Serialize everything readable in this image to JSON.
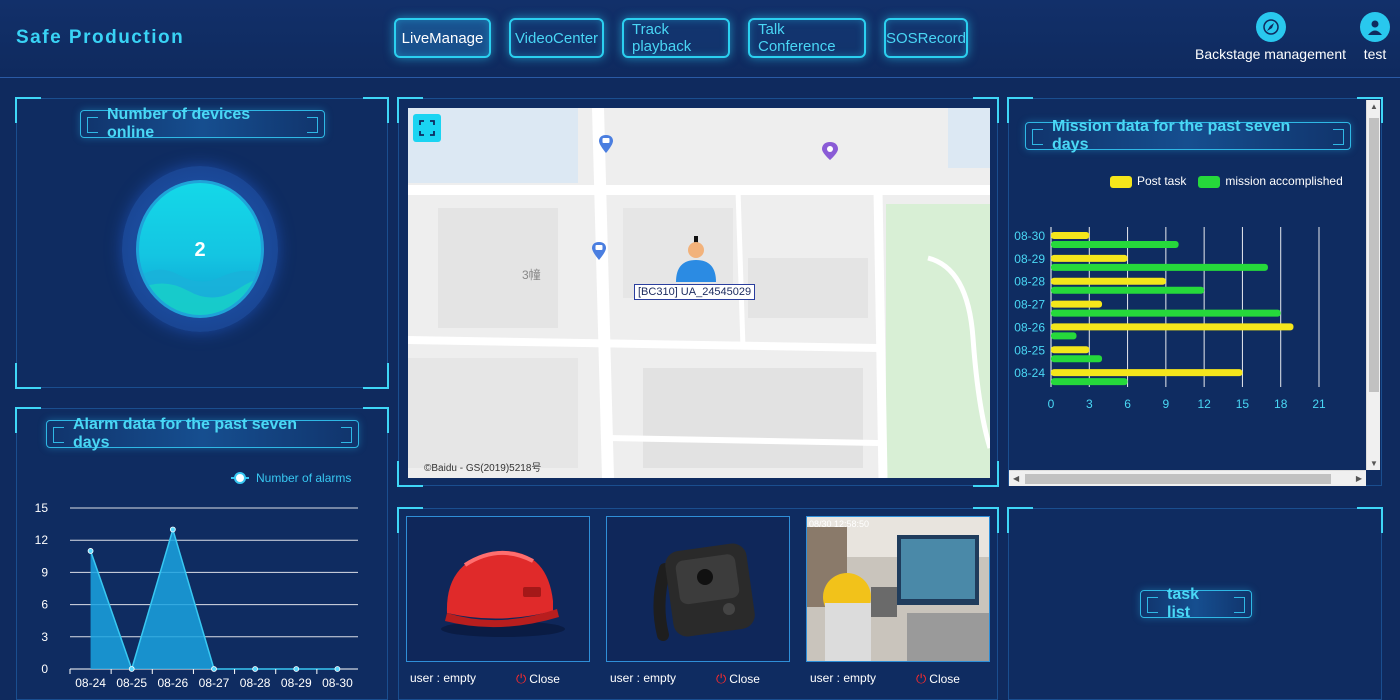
{
  "brand": "Safe Production",
  "nav": [
    "LiveManage",
    "VideoCenter",
    "Track playback",
    "Talk Conference",
    "SOSRecord"
  ],
  "header_right": {
    "backstage": "Backstage management",
    "user": "test"
  },
  "devices_online": {
    "title": "Number of devices online",
    "value": "2"
  },
  "alarm_chart": {
    "title": "Alarm data for the past seven days",
    "legend": "Number of alarms"
  },
  "mission_chart": {
    "title": "Mission data for the past seven days",
    "legend_post": "Post task",
    "legend_done": "mission accomplished"
  },
  "map": {
    "device_label": "[BC310] UA_24545029",
    "poi_label": "3幢",
    "copyright": "©Baidu - GS(2019)5218号"
  },
  "thumbnails": [
    {
      "user": "user : empty",
      "close": "Close",
      "image": "red-helmet"
    },
    {
      "user": "user : empty",
      "close": "Close",
      "image": "body-camera"
    },
    {
      "user": "user : empty",
      "close": "Close",
      "image": "video-feed",
      "overlay": "08/30 12:58:50"
    }
  ],
  "task_list": {
    "title": "task list"
  },
  "colors": {
    "accent": "#3fd7f7",
    "post_task": "#f5e61b",
    "mission_done": "#26d93b",
    "alarm_area": "#1aa3e0"
  },
  "chart_data": [
    {
      "type": "area",
      "x": [
        "08-24",
        "08-25",
        "08-26",
        "08-27",
        "08-28",
        "08-29",
        "08-30"
      ],
      "series": [
        {
          "name": "Number of alarms",
          "values": [
            11,
            0,
            13,
            0,
            0,
            0,
            0
          ]
        }
      ],
      "ylim": [
        0,
        15
      ],
      "yticks": [
        0,
        3,
        6,
        9,
        12,
        15
      ],
      "grid": true,
      "legend": "top-right"
    },
    {
      "type": "bar",
      "orientation": "horizontal",
      "categories": [
        "08-30",
        "08-29",
        "08-28",
        "08-27",
        "08-26",
        "08-25",
        "08-24"
      ],
      "series": [
        {
          "name": "Post task",
          "values": [
            3,
            6,
            9,
            4,
            19,
            3,
            15
          ]
        },
        {
          "name": "mission accomplished",
          "values": [
            10,
            17,
            12,
            18,
            2,
            4,
            6
          ]
        }
      ],
      "xlim": [
        0,
        21
      ],
      "xticks": [
        0,
        3,
        6,
        9,
        12,
        15,
        18,
        21
      ],
      "grid": true,
      "legend": "top-right"
    }
  ]
}
